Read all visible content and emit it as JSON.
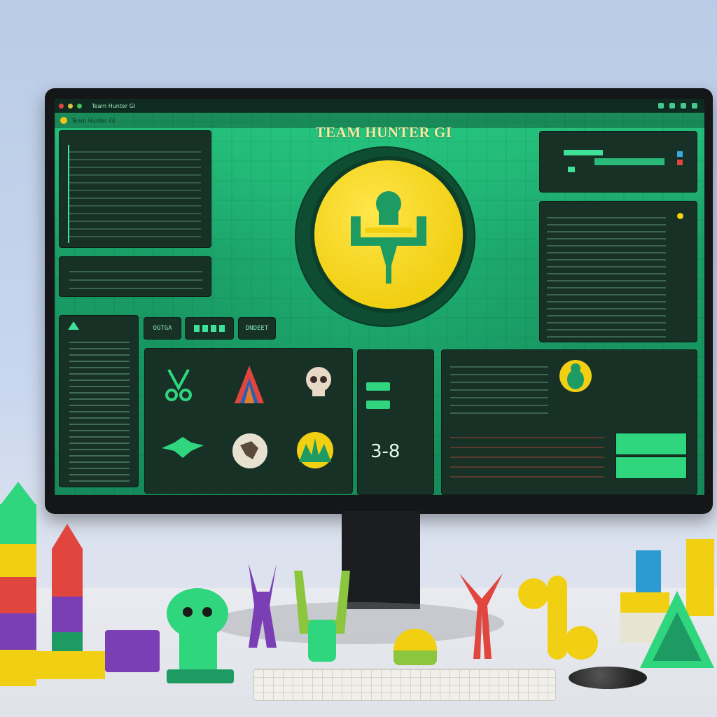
{
  "titlebar": {
    "title": "Team Hunter GI"
  },
  "tab": {
    "label": "Team Hunter GI"
  },
  "page_title": "TEAM HUNTER GI",
  "buttons": {
    "left": "OGTGA",
    "middle": "",
    "right": "DNDEET"
  },
  "score": "3-8",
  "colors": {
    "accent": "#f1cf13",
    "screen": "#1e9a63",
    "panel": "#173126",
    "text": "#8fdcb6"
  }
}
